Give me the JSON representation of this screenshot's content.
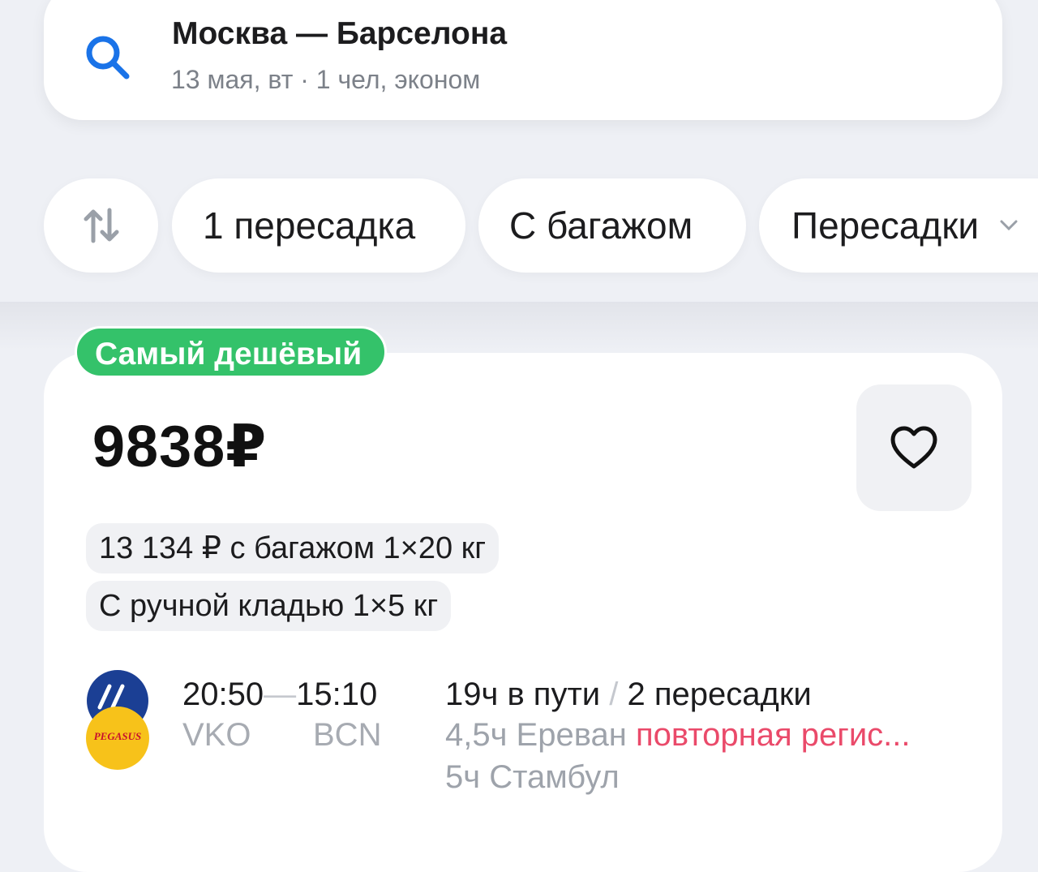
{
  "search": {
    "route": "Москва — Барселона",
    "details": "13 мая, вт · 1 чел, эконом"
  },
  "filters": {
    "sort_icon": "sort-arrows-icon",
    "chips": [
      "1 пересадка",
      "С багажом",
      "Пересадки"
    ]
  },
  "result": {
    "badge": "Самый дешёвый",
    "price": "9838₽",
    "baggage_option": "13 134 ₽ с багажом 1×20 кг",
    "hand_luggage": "С ручной кладью 1×5 кг",
    "airline_logo_text": "PEGASUS",
    "depart_time": "20:50",
    "arrive_time": "15:10",
    "depart_code": "VKO",
    "arrive_code": "BCN",
    "duration": "19ч в пути",
    "transfers": "2 пересадки",
    "stop1_text": "4,5ч Ереван",
    "stop1_warning": "повторная регис...",
    "stop2_text": "5ч Стамбул"
  },
  "colors": {
    "accent_blue": "#1a73e8",
    "badge_green": "#34c26a",
    "warning_red": "#ea4a6a",
    "background": "#eef0f5"
  }
}
